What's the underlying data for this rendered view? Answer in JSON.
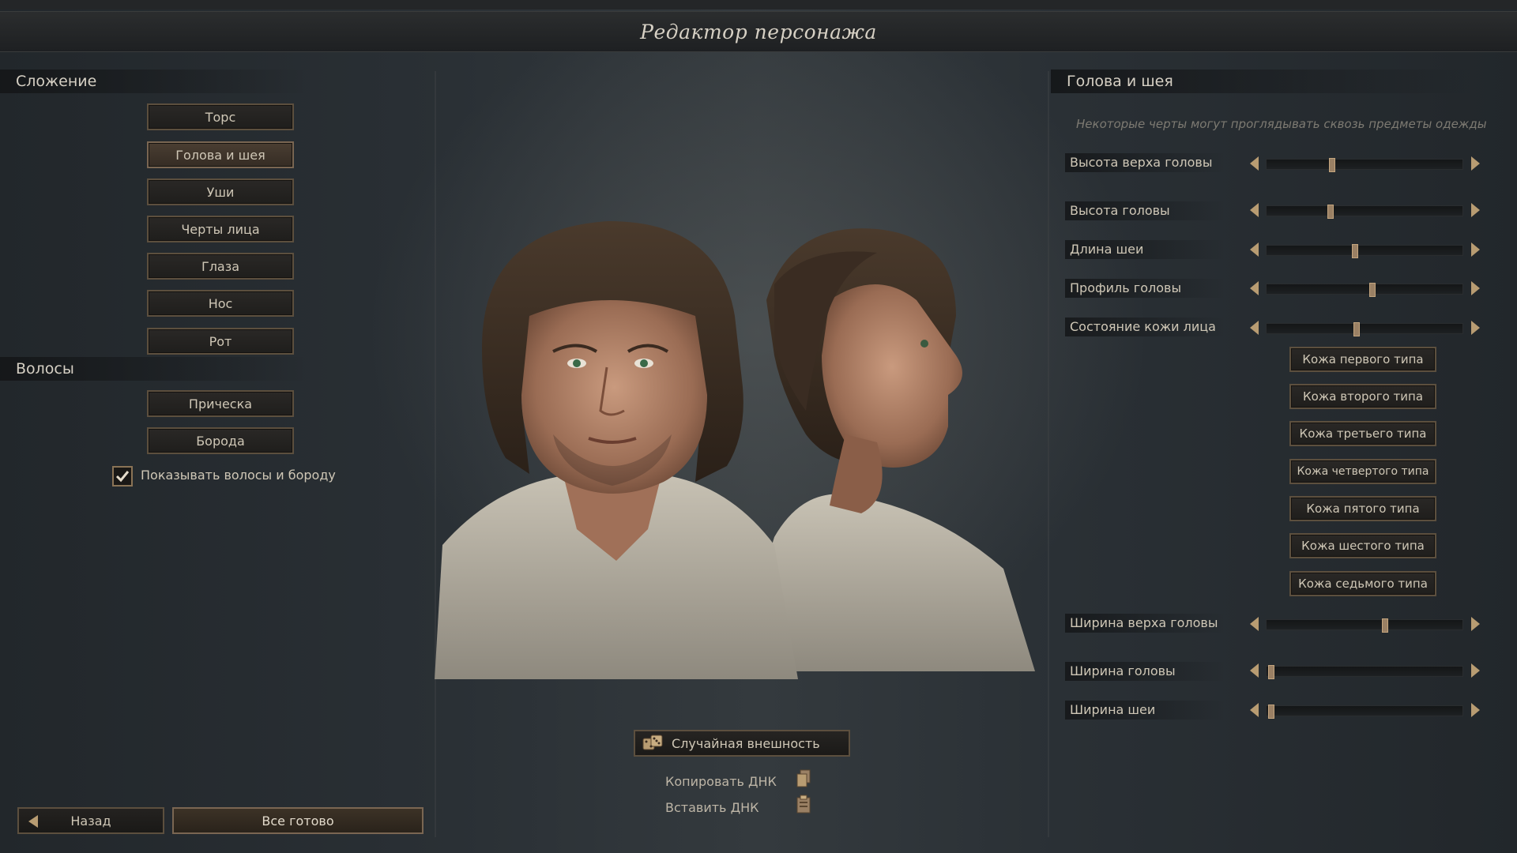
{
  "title": "Редактор персонажа",
  "left": {
    "build_header": "Сложение",
    "build_buttons": [
      "Торс",
      "Голова и шея",
      "Уши",
      "Черты лица",
      "Глаза",
      "Нос",
      "Рот"
    ],
    "active_build": "Голова и шея",
    "hair_header": "Волосы",
    "hair_buttons": [
      "Прическа",
      "Борода"
    ],
    "show_hair_label": "Показывать волосы и бороду",
    "show_hair_checked": true
  },
  "center": {
    "random_label": "Случайная внешность",
    "copy_dna": "Копировать ДНК",
    "paste_dna": "Вставить ДНК"
  },
  "bottom": {
    "back_label": "Назад",
    "done_label": "Все готово"
  },
  "right": {
    "header": "Голова и шея",
    "hint": "Некоторые черты могут проглядывать сквозь предметы одежды",
    "sliders": [
      {
        "label": "Высота верха головы",
        "value": 0.33
      },
      {
        "label": "Высота головы",
        "value": 0.32
      },
      {
        "label": "Длина шеи",
        "value": 0.45
      },
      {
        "label": "Профиль головы",
        "value": 0.54
      },
      {
        "label": "Состояние кожи лица",
        "value": 0.46
      },
      {
        "label": "Ширина верха головы",
        "value": 0.61
      },
      {
        "label": "Ширина головы",
        "value": 0.01
      },
      {
        "label": "Ширина шеи",
        "value": 0.01
      }
    ],
    "skin_buttons": [
      "Кожа первого типа",
      "Кожа второго типа",
      "Кожа третьего типа",
      "Кожа четвертого типа",
      "Кожа пятого типа",
      "Кожа шестого типа",
      "Кожа седьмого типа"
    ]
  },
  "icons": {
    "dice": "dice-icon",
    "copy": "copy-icon",
    "paste": "paste-icon",
    "check": "checkmark-icon",
    "back": "arrow-left-icon"
  },
  "colors": {
    "accent": "#b89c72",
    "border": "#5c4f3e",
    "background": "#1c2024"
  }
}
